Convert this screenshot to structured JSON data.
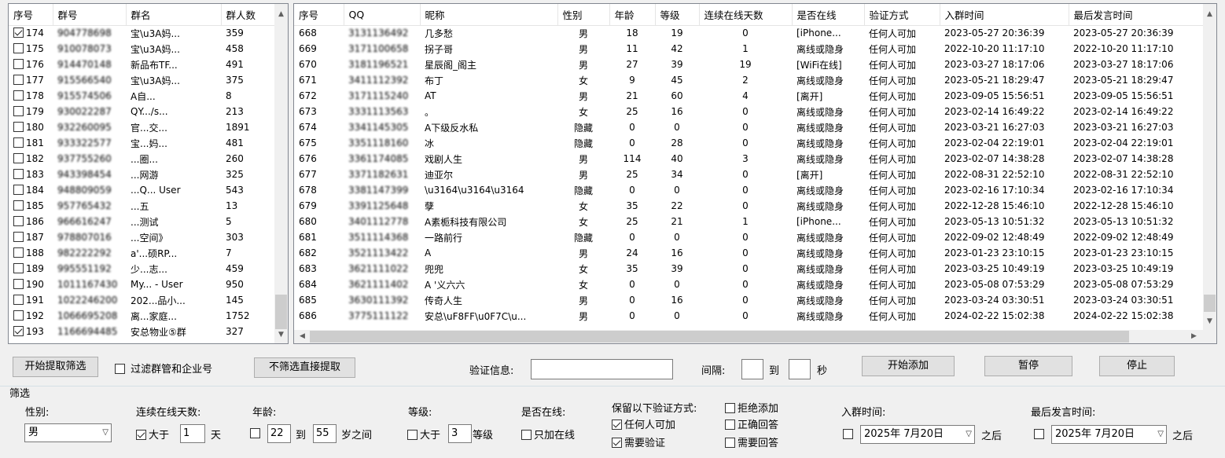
{
  "left_table": {
    "headers": [
      "序号",
      "群号",
      "群名",
      "群人数"
    ],
    "rows": [
      {
        "checked": true,
        "no": "174",
        "id": "904778698",
        "name": "宝\\u3A妈...",
        "count": "359"
      },
      {
        "checked": false,
        "no": "175",
        "id": "910078073",
        "name": "宝\\u3A妈...",
        "count": "458"
      },
      {
        "checked": false,
        "no": "176",
        "id": "914470148",
        "name": "新品布TF...",
        "count": "491"
      },
      {
        "checked": false,
        "no": "177",
        "id": "915566540",
        "name": "宝\\u3A妈...",
        "count": "375"
      },
      {
        "checked": false,
        "no": "178",
        "id": "915574506",
        "name": "A自...",
        "count": "8"
      },
      {
        "checked": false,
        "no": "179",
        "id": "930022287",
        "name": "QY.../s...",
        "count": "213"
      },
      {
        "checked": false,
        "no": "180",
        "id": "932260095",
        "name": "官...交...",
        "count": "1891"
      },
      {
        "checked": false,
        "no": "181",
        "id": "933322577",
        "name": "宝...妈...",
        "count": "481"
      },
      {
        "checked": false,
        "no": "182",
        "id": "937755260",
        "name": "...圈...",
        "count": "260"
      },
      {
        "checked": false,
        "no": "183",
        "id": "943398454",
        "name": "...网游",
        "count": "325"
      },
      {
        "checked": false,
        "no": "184",
        "id": "948809059",
        "name": "...Q... User",
        "count": "543"
      },
      {
        "checked": false,
        "no": "185",
        "id": "957765432",
        "name": "...五",
        "count": "13"
      },
      {
        "checked": false,
        "no": "186",
        "id": "966616247",
        "name": "...测试",
        "count": "5"
      },
      {
        "checked": false,
        "no": "187",
        "id": "978807016",
        "name": "...空间》",
        "count": "303"
      },
      {
        "checked": false,
        "no": "188",
        "id": "982222292",
        "name": "a'...硕RP...",
        "count": "7"
      },
      {
        "checked": false,
        "no": "189",
        "id": "995551192",
        "name": "少...志...",
        "count": "459"
      },
      {
        "checked": false,
        "no": "190",
        "id": "1011167430",
        "name": "My... - User",
        "count": "950"
      },
      {
        "checked": false,
        "no": "191",
        "id": "1022246200",
        "name": "202...品小...",
        "count": "145"
      },
      {
        "checked": false,
        "no": "192",
        "id": "1066695208",
        "name": "离...家庭...",
        "count": "1752"
      },
      {
        "checked": true,
        "no": "193",
        "id": "1166694485",
        "name": "安总物业⑤群",
        "count": "327"
      }
    ]
  },
  "right_table": {
    "headers": [
      "序号",
      "QQ",
      "昵称",
      "性别",
      "年龄",
      "等级",
      "连续在线天数",
      "是否在线",
      "验证方式",
      "入群时间",
      "最后发言时间"
    ],
    "rows": [
      [
        "668",
        "3131136492",
        "几多愁",
        "男",
        "18",
        "19",
        "0",
        "[iPhone...",
        "任何人可加",
        "2023-05-27 20:36:39",
        "2023-05-27 20:36:39"
      ],
      [
        "669",
        "3171100658",
        "拐子哥",
        "男",
        "11",
        "42",
        "1",
        "离线或隐身",
        "任何人可加",
        "2022-10-20 11:17:10",
        "2022-10-20 11:17:10"
      ],
      [
        "670",
        "3181196521",
        "星辰阁_阁主",
        "男",
        "27",
        "39",
        "19",
        "[WiFi在线]",
        "任何人可加",
        "2023-03-27 18:17:06",
        "2023-03-27 18:17:06"
      ],
      [
        "671",
        "3411112392",
        "布丁",
        "女",
        "9",
        "45",
        "2",
        "离线或隐身",
        "任何人可加",
        "2023-05-21 18:29:47",
        "2023-05-21 18:29:47"
      ],
      [
        "672",
        "3171115240",
        "AT",
        "男",
        "21",
        "60",
        "4",
        "[离开]",
        "任何人可加",
        "2023-09-05 15:56:51",
        "2023-09-05 15:56:51"
      ],
      [
        "673",
        "3331113563",
        "。",
        "女",
        "25",
        "16",
        "0",
        "离线或隐身",
        "任何人可加",
        "2023-02-14 16:49:22",
        "2023-02-14 16:49:22"
      ],
      [
        "674",
        "3341145305",
        "A下级反水私",
        "隐藏",
        "0",
        "0",
        "0",
        "离线或隐身",
        "任何人可加",
        "2023-03-21 16:27:03",
        "2023-03-21 16:27:03"
      ],
      [
        "675",
        "3351118160",
        "冰",
        "隐藏",
        "0",
        "28",
        "0",
        "离线或隐身",
        "任何人可加",
        "2023-02-04 22:19:01",
        "2023-02-04 22:19:01"
      ],
      [
        "676",
        "3361174085",
        "戏剧人生",
        "男",
        "114",
        "40",
        "3",
        "离线或隐身",
        "任何人可加",
        "2023-02-07 14:38:28",
        "2023-02-07 14:38:28"
      ],
      [
        "677",
        "3371182631",
        "迪亚尔",
        "男",
        "25",
        "34",
        "0",
        "[离开]",
        "任何人可加",
        "2022-08-31 22:52:10",
        "2022-08-31 22:52:10"
      ],
      [
        "678",
        "3381147399",
        "\\u3164\\u3164\\u3164",
        "隐藏",
        "0",
        "0",
        "0",
        "离线或隐身",
        "任何人可加",
        "2023-02-16 17:10:34",
        "2023-02-16 17:10:34"
      ],
      [
        "679",
        "3391125648",
        "孽",
        "女",
        "35",
        "22",
        "0",
        "离线或隐身",
        "任何人可加",
        "2022-12-28 15:46:10",
        "2022-12-28 15:46:10"
      ],
      [
        "680",
        "3401112778",
        "A素栀科技有限公司",
        "女",
        "25",
        "21",
        "1",
        "[iPhone...",
        "任何人可加",
        "2023-05-13 10:51:32",
        "2023-05-13 10:51:32"
      ],
      [
        "681",
        "3511114368",
        "一路前行",
        "隐藏",
        "0",
        "0",
        "0",
        "离线或隐身",
        "任何人可加",
        "2022-09-02 12:48:49",
        "2022-09-02 12:48:49"
      ],
      [
        "682",
        "3521113422",
        "A",
        "男",
        "24",
        "16",
        "0",
        "离线或隐身",
        "任何人可加",
        "2023-01-23 23:10:15",
        "2023-01-23 23:10:15"
      ],
      [
        "683",
        "3621111022",
        "兜兜",
        "女",
        "35",
        "39",
        "0",
        "离线或隐身",
        "任何人可加",
        "2023-03-25 10:49:19",
        "2023-03-25 10:49:19"
      ],
      [
        "684",
        "3621111402",
        "A '义六六",
        "女",
        "0",
        "0",
        "0",
        "离线或隐身",
        "任何人可加",
        "2023-05-08 07:53:29",
        "2023-05-08 07:53:29"
      ],
      [
        "685",
        "3630111392",
        "传奇人生",
        "男",
        "0",
        "16",
        "0",
        "离线或隐身",
        "任何人可加",
        "2023-03-24 03:30:51",
        "2023-03-24 03:30:51"
      ],
      [
        "686",
        "3775111122",
        "安总\\uF8FF\\u0F7C\\u...",
        "男",
        "0",
        "0",
        "0",
        "离线或隐身",
        "任何人可加",
        "2024-02-22 15:02:38",
        "2024-02-22 15:02:38"
      ]
    ]
  },
  "toolbar": {
    "start_filter_label": "开始提取筛选",
    "filter_admin_label": "过滤群管和企业号",
    "no_filter_label": "不筛选直接提取",
    "verify_label": "验证信息:",
    "verify_value": "",
    "interval_label": "间隔:",
    "to_label": "到",
    "sec_label": "秒",
    "interval_from": "",
    "interval_to": "",
    "start_add_label": "开始添加",
    "pause_label": "暂停",
    "stop_label": "停止"
  },
  "filter": {
    "group_title": "筛选",
    "gender_label": "性别:",
    "gender_value": "男",
    "online_days_label": "连续在线天数:",
    "online_days_gt_label": "大于",
    "online_days_value": "1",
    "online_days_unit": "天",
    "age_label": "年龄:",
    "age_from": "22",
    "age_to_label": "到",
    "age_to": "55",
    "age_unit": "岁之间",
    "level_label": "等级:",
    "level_gt_label": "大于",
    "level_value": "3",
    "level_unit": "等级",
    "online_label": "是否在线:",
    "online_only_label": "只加在线",
    "keep_verify_label": "保留以下验证方式:",
    "verify_anyone_label": "任何人可加",
    "verify_need_label": "需要验证",
    "reject_label": "拒绝添加",
    "correct_answer_label": "正确回答",
    "need_answer_label": "需要回答",
    "join_time_label": "入群时间:",
    "join_date": "2025年 7月20日",
    "after_label": "之后",
    "last_speak_label": "最后发言时间:",
    "last_speak_date": "2025年 7月20日",
    "after_label2": "之后"
  }
}
